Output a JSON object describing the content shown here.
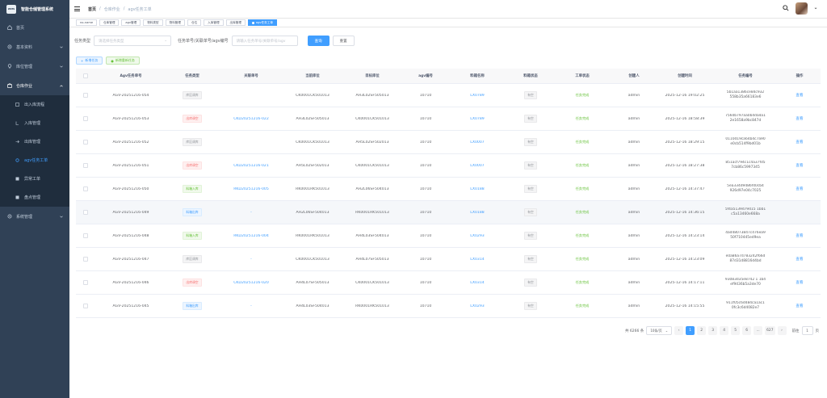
{
  "app": {
    "logo_text": "WMS",
    "title": "智能仓储管理系统"
  },
  "sidebar": {
    "items": [
      {
        "icon": "home-icon",
        "label": "首页"
      },
      {
        "icon": "gear-icon",
        "label": "基本资料"
      },
      {
        "icon": "location-icon",
        "label": "库位管理"
      },
      {
        "icon": "warehouse-icon",
        "label": "仓库作业"
      }
    ],
    "sub_items": [
      {
        "icon": "list-icon",
        "label": "出入库流程"
      },
      {
        "icon": "inbound-icon",
        "label": "入库管理"
      },
      {
        "icon": "outbound-icon",
        "label": "出库管理"
      },
      {
        "icon": "agv-icon",
        "label": "agv任务工单"
      },
      {
        "icon": "grid-icon",
        "label": "异常工单"
      },
      {
        "icon": "grid-icon",
        "label": "盘点管理"
      }
    ],
    "last_item": {
      "icon": "gear-icon",
      "label": "系统管理"
    }
  },
  "breadcrumb": [
    "首页",
    "仓库作业",
    "agv任务工单"
  ],
  "tags": [
    "no-name",
    "仓库管理",
    "agv管理",
    "物料类型",
    "物料管理",
    "仓位",
    "入库管理",
    "出库管理",
    "agv任务工单"
  ],
  "filters": {
    "type_label": "任务类型",
    "type_placeholder": "请选择任务类型",
    "no_label": "任务单号/关联单号/agv编号",
    "no_placeholder": "请输入任务单号/关联单号/agv",
    "search": "查询",
    "reset": "重置"
  },
  "actions": {
    "add": "新增任务",
    "outbound": "新增重新任务"
  },
  "table": {
    "headers": [
      "Agv任务单号",
      "任务类型",
      "关联单号",
      "当前库位",
      "目标库位",
      "agv编号",
      "料箱名称",
      "料箱状态",
      "工单状态",
      "创建人",
      "创建时间",
      "任务编号",
      "操作"
    ],
    "rows": [
      {
        "no": "AGV-20251216-054",
        "type": "库区调库",
        "type_color": "info",
        "ref": "",
        "cur": "CK0001CK501013",
        "tgt": "AH3L02SF505013",
        "agv": "10710",
        "box": "LX0789",
        "box_status": "有空",
        "status": "任务完成",
        "creator": "admin",
        "time": "2025-12-16 19:02:25",
        "task1": "5b1aa1386ce84c932",
        "task2": "558b35a66183e6",
        "op": "查看"
      },
      {
        "no": "AGV-20251216-053",
        "type": "出库调空",
        "type_color": "danger",
        "ref": "CKD20251216-022",
        "cur": "AH3L02SF505013",
        "tgt": "CK0001CK501013",
        "agv": "10710",
        "box": "LX0789",
        "box_status": "有空",
        "status": "任务完成",
        "creator": "admin",
        "time": "2025-12-16 18:58:39",
        "task1": "7560b797aa0b4da4a1",
        "task2": "2e1658a9bc847d",
        "op": "查看"
      },
      {
        "no": "AGV-20251216-052",
        "type": "库区调库",
        "type_color": "info",
        "ref": "",
        "cur": "CK0001CK501013",
        "tgt": "AH5L02SF502013",
        "agv": "10710",
        "box": "LX0007",
        "box_status": "有空",
        "status": "任务完成",
        "creator": "admin",
        "time": "2025-12-16 18:29:15",
        "task1": "0110d19ca64b4c7a90",
        "task2": "e0cb514f9bd01b",
        "op": "查看"
      },
      {
        "no": "AGV-20251216-051",
        "type": "出库调空",
        "type_color": "danger",
        "ref": "CKD20251216-021",
        "cur": "AH5L02SF502013",
        "tgt": "CK0001CK501013",
        "agv": "10710",
        "box": "LX0007",
        "box_status": "有空",
        "status": "任务完成",
        "creator": "admin",
        "time": "2025-12-16 18:27:38",
        "task1": "851acf794c1c4a37fd5",
        "task2": "7cb86c5997345",
        "op": "查看"
      },
      {
        "no": "AGV-20251216-050",
        "type": "料箱入库",
        "type_color": "success",
        "ref": "RKD20251216-005",
        "cur": "RK0001RK501013",
        "tgt": "AH2L06SF504013",
        "agv": "10710",
        "box": "LX0188",
        "box_status": "有空",
        "status": "任务完成",
        "creator": "admin",
        "time": "2025-12-16 14:37:47",
        "task1": "5ea334d9486f40cb4",
        "task2": "926d97e04c7025",
        "op": "查看"
      },
      {
        "no": "AGV-20251216-049",
        "type": "料箱出库",
        "type_color": "primary",
        "ref": "-",
        "cur": "AH2L06SF504013",
        "tgt": "RK0001RK501013",
        "agv": "10710",
        "box": "LX0188",
        "box_status": "有空",
        "status": "任务完成",
        "creator": "admin",
        "time": "2025-12-16 14:36:15",
        "task1": "5f4a5139d79415 1bb1",
        "task2": "c5a13460e668a",
        "op": ""
      },
      {
        "no": "AGV-20251216-048",
        "type": "料箱入库",
        "type_color": "success",
        "ref": "RKD20251216-004",
        "cur": "RK0001RK501013",
        "tgt": "AH4L03SF504013",
        "agv": "10710",
        "box": "LX0293",
        "box_status": "有空",
        "status": "任务完成",
        "creator": "admin",
        "time": "2025-12-16 14:23:14",
        "task1": "4ad48073847c476ea9",
        "task2": "50f710445ed9ea",
        "op": "查看"
      },
      {
        "no": "AGV-20251216-047",
        "type": "库区调库",
        "type_color": "info",
        "ref": "-",
        "cur": "CK0001CK501013",
        "tgt": "AH4L07SF505013",
        "agv": "10710",
        "box": "LX0314",
        "box_status": "有空",
        "status": "任务完成",
        "creator": "admin",
        "time": "2025-12-16 14:23:09",
        "task1": "e0a86a7d783242f66d",
        "task2": "87d31d8816d4bd",
        "op": "查看"
      },
      {
        "no": "AGV-20251216-046",
        "type": "出库调空",
        "type_color": "danger",
        "ref": "CKD20251216-020",
        "cur": "AH4L07SF505013",
        "tgt": "CK0001CK501013",
        "agv": "10710",
        "box": "LX0314",
        "box_status": "有空",
        "status": "任务完成",
        "creator": "admin",
        "time": "2025-12-16 14:17:11",
        "task1": "93083d35e8742 1 1b4",
        "task2": "ef9436b5a3de70",
        "op": "查看"
      },
      {
        "no": "AGV-20251216-045",
        "type": "料箱出库",
        "type_color": "primary",
        "ref": "-",
        "cur": "AH4L03SF504013",
        "tgt": "RK0001RK501013",
        "agv": "10710",
        "box": "LX0293",
        "box_status": "有空",
        "status": "任务完成",
        "creator": "admin",
        "time": "2025-12-16 14:15:55",
        "task1": "911f05c6d484ca1ac1",
        "task2": "0fc3c6d4082e7",
        "op": "查看"
      }
    ]
  },
  "pager": {
    "total": "共 6266 条",
    "size": "10条/页",
    "pages": [
      "1",
      "2",
      "3",
      "4",
      "5",
      "6",
      "...",
      "627"
    ],
    "goto": "前往",
    "goto_value": "1",
    "unit": "页"
  },
  "colors": {
    "sidebar_bg": "#304156",
    "accent": "#409eff"
  }
}
